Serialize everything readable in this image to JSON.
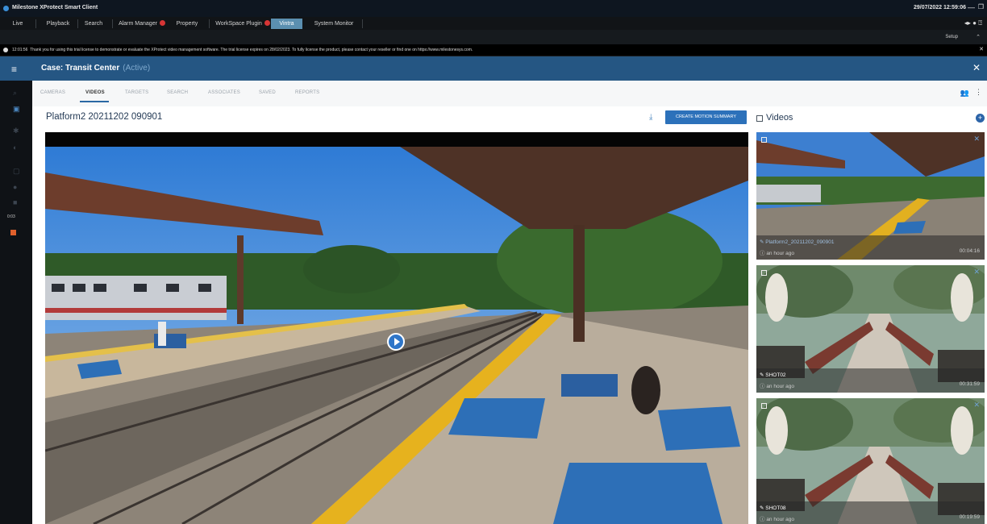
{
  "window": {
    "app_title": "Milestone XProtect Smart Client",
    "datetime": "29/07/2022 12:59:06"
  },
  "main_tabs": [
    {
      "label": "Live"
    },
    {
      "label": "Playback"
    },
    {
      "label": "Search"
    },
    {
      "label": "Alarm Manager"
    },
    {
      "label": "Property"
    },
    {
      "label": "WorkSpace Plugin"
    },
    {
      "label": "Vintra"
    },
    {
      "label": "System Monitor"
    }
  ],
  "setup_label": "Setup",
  "notice": {
    "time": "12:01:56",
    "text": "Thank you for using this trial license to demonstrate or evaluate the XProtect video management software. The trial license expires on 28/02/2023. To fully license the product, please contact your reseller or find one on https://www.milestonesys.com."
  },
  "case": {
    "title": "Case: Transit Center",
    "status": "(Active)"
  },
  "sub_tabs": [
    {
      "label": "CAMERAS"
    },
    {
      "label": "VIDEOS"
    },
    {
      "label": "TARGETS"
    },
    {
      "label": "SEARCH"
    },
    {
      "label": "ASSOCIATES"
    },
    {
      "label": "SAVED"
    },
    {
      "label": "REPORTS"
    }
  ],
  "active_sub_tab": "VIDEOS",
  "video_title": "Platform2 20211202 090901",
  "motion_summary_label": "CREATE MOTION SUMMARY",
  "videos_panel": {
    "title": "Videos",
    "items": [
      {
        "name": "Platform2_20211202_090901",
        "ago": "an hour ago",
        "duration": "00:04:16"
      },
      {
        "name": "SHOT02",
        "ago": "an hour ago",
        "duration": "00:31:59"
      },
      {
        "name": "SHOT08",
        "ago": "an hour ago",
        "duration": "00:19:59"
      }
    ]
  },
  "sidebar_time": "0:03",
  "colors": {
    "accent": "#255683",
    "button": "#2c71ba",
    "active_tab": "#5b8fb0",
    "alert_badge": "#d63535",
    "record": "#e0602c"
  }
}
